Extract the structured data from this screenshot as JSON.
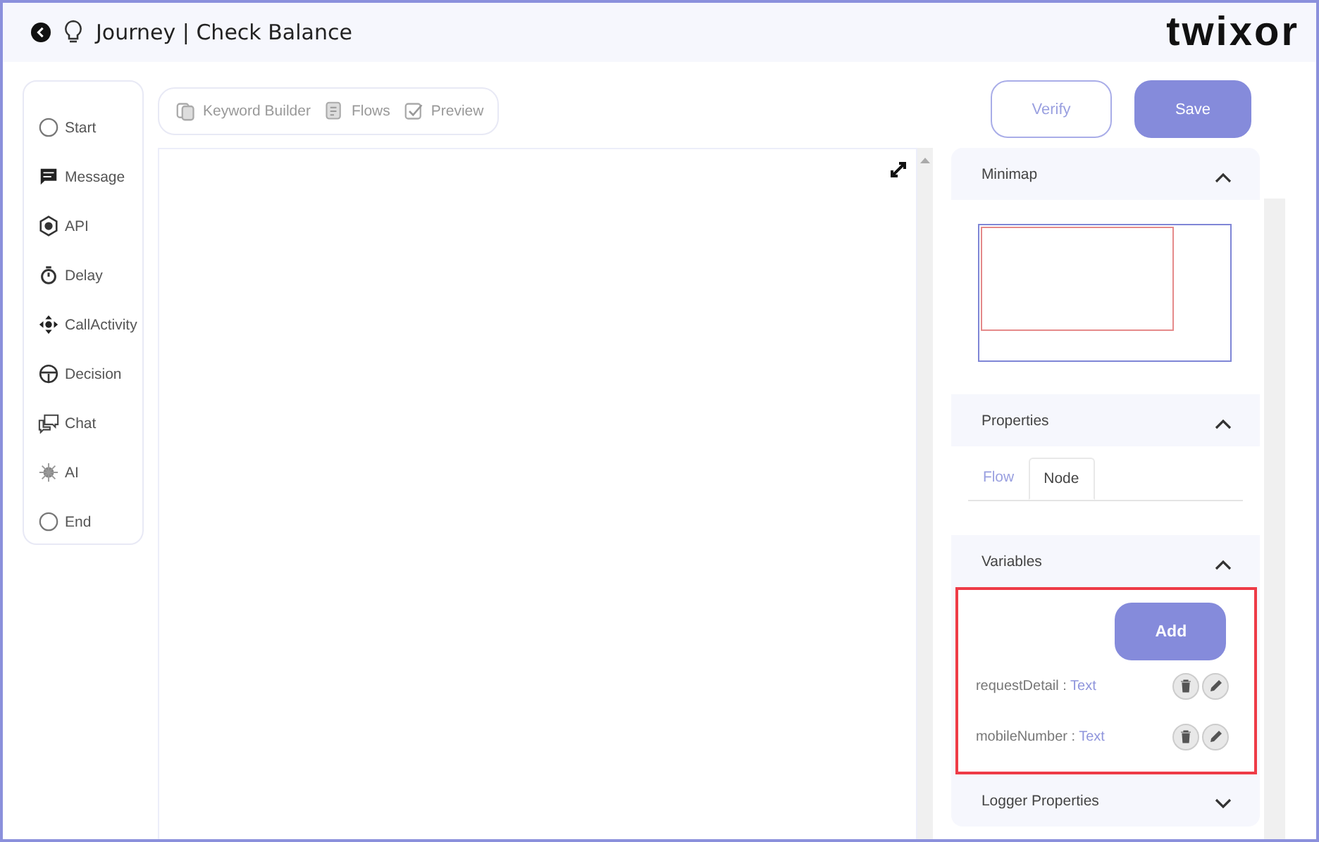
{
  "header": {
    "title": "Journey | Check Balance",
    "logo": "twixor"
  },
  "palette": [
    {
      "label": "Start",
      "kind": "start"
    },
    {
      "label": "Message",
      "kind": "message"
    },
    {
      "label": "API",
      "kind": "api"
    },
    {
      "label": "Delay",
      "kind": "delay"
    },
    {
      "label": "CallActivity",
      "kind": "callactivity"
    },
    {
      "label": "Decision",
      "kind": "decision"
    },
    {
      "label": "Chat",
      "kind": "chat"
    },
    {
      "label": "AI",
      "kind": "ai"
    },
    {
      "label": "End",
      "kind": "end"
    }
  ],
  "toolbar": [
    {
      "label": "Keyword Builder",
      "kind": "keyword"
    },
    {
      "label": "Flows",
      "kind": "flows"
    },
    {
      "label": "Preview",
      "kind": "preview"
    }
  ],
  "actions": [
    {
      "label": "Verify",
      "kind": "outline"
    },
    {
      "label": "Save",
      "kind": "filled"
    }
  ],
  "panel": {
    "minimap": {
      "title": "Minimap",
      "expanded": true
    },
    "properties": {
      "title": "Properties",
      "expanded": true,
      "tabs": [
        {
          "label": "Flow",
          "selected": false
        },
        {
          "label": "Node",
          "selected": true
        }
      ]
    },
    "variables": {
      "title": "Variables",
      "expanded": true,
      "highlighted": true,
      "add_label": "Add",
      "items": [
        {
          "name": "requestDetail",
          "separator": " : ",
          "type": "Text"
        },
        {
          "name": "mobileNumber",
          "separator": " : ",
          "type": "Text"
        }
      ]
    },
    "logger": {
      "title": "Logger Properties",
      "expanded": false
    }
  }
}
